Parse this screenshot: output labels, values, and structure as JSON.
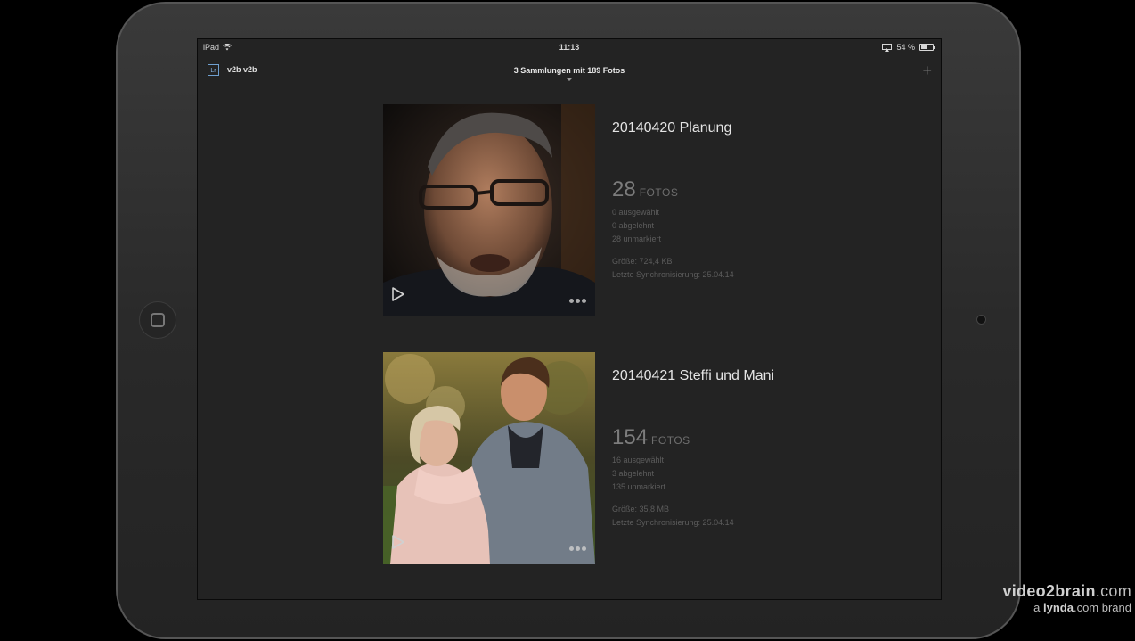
{
  "statusbar": {
    "device": "iPad",
    "time": "11:13",
    "battery": "54 %",
    "battery_level": 0.54
  },
  "navbar": {
    "app_badge": "Lr",
    "user": "v2b v2b",
    "title": "3 Sammlungen mit 189 Fotos",
    "add_symbol": "+"
  },
  "collections": [
    {
      "title": "20140420 Planung",
      "count": "28",
      "count_label": "FOTOS",
      "selected": "0 ausgewählt",
      "rejected": "0 abgelehnt",
      "unmarked": "28 unmarkiert",
      "size": "Größe: 724,4 KB",
      "last_sync": "Letzte Synchronisierung: 25.04.14"
    },
    {
      "title": "20140421 Steffi und Mani",
      "count": "154",
      "count_label": "FOTOS",
      "selected": "16 ausgewählt",
      "rejected": "3 abgelehnt",
      "unmarked": "135 unmarkiert",
      "size": "Größe: 35,8 MB",
      "last_sync": "Letzte Synchronisierung: 25.04.14"
    }
  ],
  "watermark": {
    "brand": "video2brain",
    "brand_suffix": ".com",
    "tagline_prefix": "a ",
    "tagline_brand": "lynda",
    "tagline_suffix": ".com brand"
  },
  "icons": {
    "wifi": "wifi-icon",
    "airplay": "airplay-icon",
    "battery": "battery-icon",
    "play": "play-icon",
    "more": "more-icon",
    "home": "home-button-icon"
  }
}
